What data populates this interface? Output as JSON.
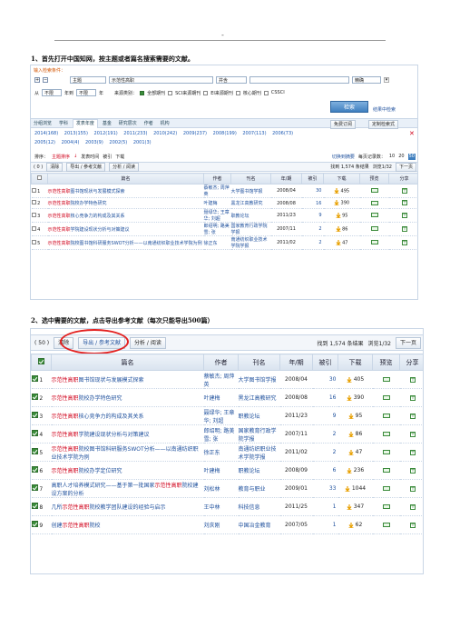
{
  "page": {
    "header_mark": "-",
    "step1": "1、首先打开中国知网，按主题或者篇名搜索需要的文献。",
    "step2": "2、选中需要的文献，点击导出参考文献（每次只能导出500篇）"
  },
  "search": {
    "condition_label": "输入检索条件：",
    "field": "主题",
    "query": "示范性高职",
    "logic": "并含",
    "match": "精确",
    "from_label": "从",
    "from_year": "不限",
    "to_label": "年到",
    "to_year": "不限",
    "year_suffix": "年",
    "source_label": "来源类别：",
    "sources": [
      {
        "label": "全部期刊",
        "checked": true
      },
      {
        "label": "SCI来源期刊",
        "checked": false
      },
      {
        "label": "EI来源期刊",
        "checked": false
      },
      {
        "label": "核心期刊",
        "checked": false
      },
      {
        "label": "CSSCI",
        "checked": false
      }
    ],
    "search_button": "检索",
    "result_search": "结果中检索"
  },
  "group": {
    "label": "分组浏览",
    "tabs": [
      "学科",
      "发表年度",
      "基金",
      "研究层次",
      "作者",
      "机构"
    ],
    "selected_tab": "发表年度",
    "right_buttons": [
      "免费订阅",
      "定制检索式"
    ],
    "years": [
      "2014(168)",
      "2013(155)",
      "2012(191)",
      "2011(233)",
      "2010(242)",
      "2009(237)",
      "2008(199)",
      "2007(113)",
      "2006(73)",
      "2005(12)",
      "2004(4)",
      "2003(9)",
      "2002(5)",
      "2001(3)"
    ]
  },
  "sort": {
    "label": "排序：",
    "options": [
      "主题排序",
      "发表时间",
      "被引",
      "下载"
    ],
    "switch": "切换到摘要",
    "per_page_label": "每页记录数：",
    "per_page": [
      "10",
      "20",
      "50"
    ]
  },
  "toolbar": {
    "selected": "( 0 )",
    "clear": "清除",
    "export": "导出 / 参考文献",
    "analyze": "分析 / 阅读",
    "found": "找到 1,574 条结果",
    "page": "浏览1/32",
    "next": "下一页"
  },
  "table_headers": [
    "篇名",
    "作者",
    "刊名",
    "年/期",
    "被引",
    "下载",
    "预览",
    "分享"
  ],
  "shot1_rows": [
    {
      "n": "1",
      "kw": "示范性高职",
      "rest": "图书馆现状与发展模式探索",
      "author": "蔡敏杰; 周萍英",
      "journal": "大学图书馆学报",
      "year": "2008/04",
      "cite": "30",
      "dl": "495"
    },
    {
      "n": "2",
      "kw": "示范性高职",
      "rest": "院校办学特色研究",
      "author": "叶建梅",
      "journal": "黑龙江高教研究",
      "year": "2008/08",
      "cite": "16",
      "dl": "390"
    },
    {
      "n": "3",
      "kw": "示范性高职",
      "rest": "核心竞争力的构成及其关系",
      "author": "聂绿华; 王章华; 刘超",
      "journal": "职教论坛",
      "year": "2011/23",
      "cite": "9",
      "dl": "95"
    },
    {
      "n": "4",
      "kw": "示范性高职",
      "rest": "学院建设现状分析与对策建议",
      "author": "郎绍明; 路美雪; 张",
      "journal": "国家教育行政学院学报",
      "year": "2007/11",
      "cite": "2",
      "dl": "86"
    },
    {
      "n": "5",
      "kw": "示范性高职",
      "rest": "院校图书馆科研服务SWOT分析——以南通纺织职业技术学院为例",
      "author": "徐正东",
      "journal": "南通纺织职业技术学院学报",
      "year": "2011/02",
      "cite": "2",
      "dl": "47"
    }
  ],
  "shot2_rows": [
    {
      "n": "1",
      "pre": "",
      "kw": "示范性高职",
      "rest": "图书馆现状与发展模式探索",
      "author": "蔡敏杰; 周萍英",
      "journal": "大学图书馆学报",
      "year": "2008/04",
      "cite": "30",
      "dl": "405"
    },
    {
      "n": "2",
      "pre": "",
      "kw": "示范性高职",
      "rest": "院校办学特色研究",
      "author": "叶建梅",
      "journal": "黑龙江高教研究",
      "year": "2008/08",
      "cite": "16",
      "dl": "390"
    },
    {
      "n": "3",
      "pre": "",
      "kw": "示范性高职",
      "rest": "核心竞争力的构成及其关系",
      "author": "聂绿华; 王章华; 刘超",
      "journal": "职教论坛",
      "year": "2011/23",
      "cite": "9",
      "dl": "95"
    },
    {
      "n": "4",
      "pre": "",
      "kw": "示范性高职",
      "rest": "学院建设现状分析与对策建议",
      "author": "郎绍明; 路美雪; 张",
      "journal": "国家教育行政学院学报",
      "year": "2007/11",
      "cite": "2",
      "dl": "86"
    },
    {
      "n": "5",
      "pre": "",
      "kw": "示范性高职",
      "rest": "院校图书馆科研服务SWOT分析——以南通纺织职业技术学院为例",
      "author": "徐正东",
      "journal": "南通纺织职业技术学院学报",
      "year": "2011/02",
      "cite": "2",
      "dl": "47"
    },
    {
      "n": "6",
      "pre": "",
      "kw": "示范性高职",
      "rest": "院校办学定位研究",
      "author": "叶建梅",
      "journal": "职教论坛",
      "year": "2008/09",
      "cite": "6",
      "dl": "236"
    },
    {
      "n": "7",
      "pre": "高职人才培养模式研究——基于第一批国家",
      "kw": "示范性高职",
      "rest": "院校建设方案的分析",
      "author": "刘松林",
      "journal": "教育与职业",
      "year": "2009/01",
      "cite": "33",
      "dl": "1044"
    },
    {
      "n": "8",
      "pre": "几所",
      "kw": "示范性高职",
      "rest": "院校教学团队建设的经验与启示",
      "author": "王中林",
      "journal": "科技信息",
      "year": "2011/25",
      "cite": "1",
      "dl": "347"
    },
    {
      "n": "9",
      "pre": "创建",
      "kw": "示范性高职",
      "rest": "院校",
      "author": "刘庆刚",
      "journal": "中国冶金教育",
      "year": "2007/05",
      "cite": "1",
      "dl": "62"
    }
  ],
  "shot2_toolbar": {
    "selected": "( 50 )",
    "clear": "清除",
    "export": "导出 / 参考文献",
    "analyze": "分析 / 阅读",
    "found": "找到 1,574 条结果",
    "page": "浏览1/32",
    "next": "下一页"
  },
  "colors": {
    "keyword": "#d0021b",
    "highlight_circle": "#e3201f",
    "accent": "#3f7fbf"
  }
}
